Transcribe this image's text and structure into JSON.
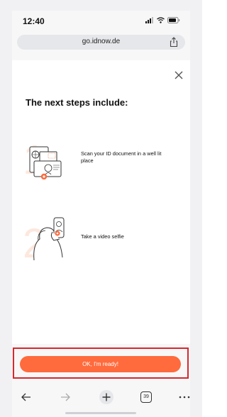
{
  "status_bar": {
    "time": "12:40"
  },
  "browser": {
    "url": "go.idnow.de",
    "tab_count": "39"
  },
  "main": {
    "heading": "The next steps include:",
    "steps": [
      {
        "number": "1",
        "text": "Scan your ID document in a well lit place"
      },
      {
        "number": "2",
        "text": "Take a video selfie"
      }
    ]
  },
  "footer": {
    "ready_button_label": "OK, I'm ready!"
  },
  "colors": {
    "accent": "#ff6b3d",
    "highlight_border": "#d7282f"
  }
}
